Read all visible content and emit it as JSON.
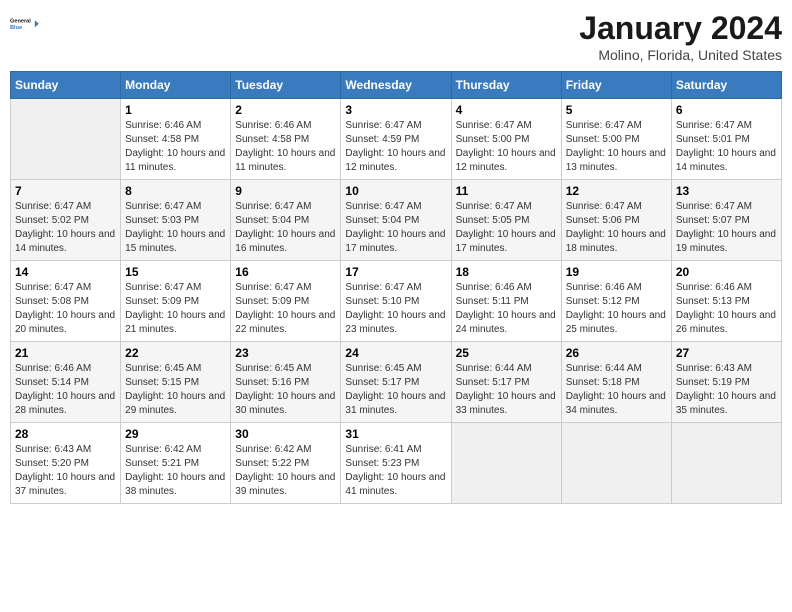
{
  "logo": {
    "text_general": "General",
    "text_blue": "Blue"
  },
  "title": "January 2024",
  "subtitle": "Molino, Florida, United States",
  "days_of_week": [
    "Sunday",
    "Monday",
    "Tuesday",
    "Wednesday",
    "Thursday",
    "Friday",
    "Saturday"
  ],
  "weeks": [
    [
      {
        "day": "",
        "empty": true
      },
      {
        "day": "1",
        "sunrise": "6:46 AM",
        "sunset": "4:58 PM",
        "daylight": "10 hours and 11 minutes."
      },
      {
        "day": "2",
        "sunrise": "6:46 AM",
        "sunset": "4:58 PM",
        "daylight": "10 hours and 11 minutes."
      },
      {
        "day": "3",
        "sunrise": "6:47 AM",
        "sunset": "4:59 PM",
        "daylight": "10 hours and 12 minutes."
      },
      {
        "day": "4",
        "sunrise": "6:47 AM",
        "sunset": "5:00 PM",
        "daylight": "10 hours and 12 minutes."
      },
      {
        "day": "5",
        "sunrise": "6:47 AM",
        "sunset": "5:00 PM",
        "daylight": "10 hours and 13 minutes."
      },
      {
        "day": "6",
        "sunrise": "6:47 AM",
        "sunset": "5:01 PM",
        "daylight": "10 hours and 14 minutes."
      }
    ],
    [
      {
        "day": "7",
        "sunrise": "6:47 AM",
        "sunset": "5:02 PM",
        "daylight": "10 hours and 14 minutes."
      },
      {
        "day": "8",
        "sunrise": "6:47 AM",
        "sunset": "5:03 PM",
        "daylight": "10 hours and 15 minutes."
      },
      {
        "day": "9",
        "sunrise": "6:47 AM",
        "sunset": "5:04 PM",
        "daylight": "10 hours and 16 minutes."
      },
      {
        "day": "10",
        "sunrise": "6:47 AM",
        "sunset": "5:04 PM",
        "daylight": "10 hours and 17 minutes."
      },
      {
        "day": "11",
        "sunrise": "6:47 AM",
        "sunset": "5:05 PM",
        "daylight": "10 hours and 17 minutes."
      },
      {
        "day": "12",
        "sunrise": "6:47 AM",
        "sunset": "5:06 PM",
        "daylight": "10 hours and 18 minutes."
      },
      {
        "day": "13",
        "sunrise": "6:47 AM",
        "sunset": "5:07 PM",
        "daylight": "10 hours and 19 minutes."
      }
    ],
    [
      {
        "day": "14",
        "sunrise": "6:47 AM",
        "sunset": "5:08 PM",
        "daylight": "10 hours and 20 minutes."
      },
      {
        "day": "15",
        "sunrise": "6:47 AM",
        "sunset": "5:09 PM",
        "daylight": "10 hours and 21 minutes."
      },
      {
        "day": "16",
        "sunrise": "6:47 AM",
        "sunset": "5:09 PM",
        "daylight": "10 hours and 22 minutes."
      },
      {
        "day": "17",
        "sunrise": "6:47 AM",
        "sunset": "5:10 PM",
        "daylight": "10 hours and 23 minutes."
      },
      {
        "day": "18",
        "sunrise": "6:46 AM",
        "sunset": "5:11 PM",
        "daylight": "10 hours and 24 minutes."
      },
      {
        "day": "19",
        "sunrise": "6:46 AM",
        "sunset": "5:12 PM",
        "daylight": "10 hours and 25 minutes."
      },
      {
        "day": "20",
        "sunrise": "6:46 AM",
        "sunset": "5:13 PM",
        "daylight": "10 hours and 26 minutes."
      }
    ],
    [
      {
        "day": "21",
        "sunrise": "6:46 AM",
        "sunset": "5:14 PM",
        "daylight": "10 hours and 28 minutes."
      },
      {
        "day": "22",
        "sunrise": "6:45 AM",
        "sunset": "5:15 PM",
        "daylight": "10 hours and 29 minutes."
      },
      {
        "day": "23",
        "sunrise": "6:45 AM",
        "sunset": "5:16 PM",
        "daylight": "10 hours and 30 minutes."
      },
      {
        "day": "24",
        "sunrise": "6:45 AM",
        "sunset": "5:17 PM",
        "daylight": "10 hours and 31 minutes."
      },
      {
        "day": "25",
        "sunrise": "6:44 AM",
        "sunset": "5:17 PM",
        "daylight": "10 hours and 33 minutes."
      },
      {
        "day": "26",
        "sunrise": "6:44 AM",
        "sunset": "5:18 PM",
        "daylight": "10 hours and 34 minutes."
      },
      {
        "day": "27",
        "sunrise": "6:43 AM",
        "sunset": "5:19 PM",
        "daylight": "10 hours and 35 minutes."
      }
    ],
    [
      {
        "day": "28",
        "sunrise": "6:43 AM",
        "sunset": "5:20 PM",
        "daylight": "10 hours and 37 minutes."
      },
      {
        "day": "29",
        "sunrise": "6:42 AM",
        "sunset": "5:21 PM",
        "daylight": "10 hours and 38 minutes."
      },
      {
        "day": "30",
        "sunrise": "6:42 AM",
        "sunset": "5:22 PM",
        "daylight": "10 hours and 39 minutes."
      },
      {
        "day": "31",
        "sunrise": "6:41 AM",
        "sunset": "5:23 PM",
        "daylight": "10 hours and 41 minutes."
      },
      {
        "day": "",
        "empty": true
      },
      {
        "day": "",
        "empty": true
      },
      {
        "day": "",
        "empty": true
      }
    ]
  ],
  "labels": {
    "sunrise": "Sunrise:",
    "sunset": "Sunset:",
    "daylight": "Daylight:"
  }
}
